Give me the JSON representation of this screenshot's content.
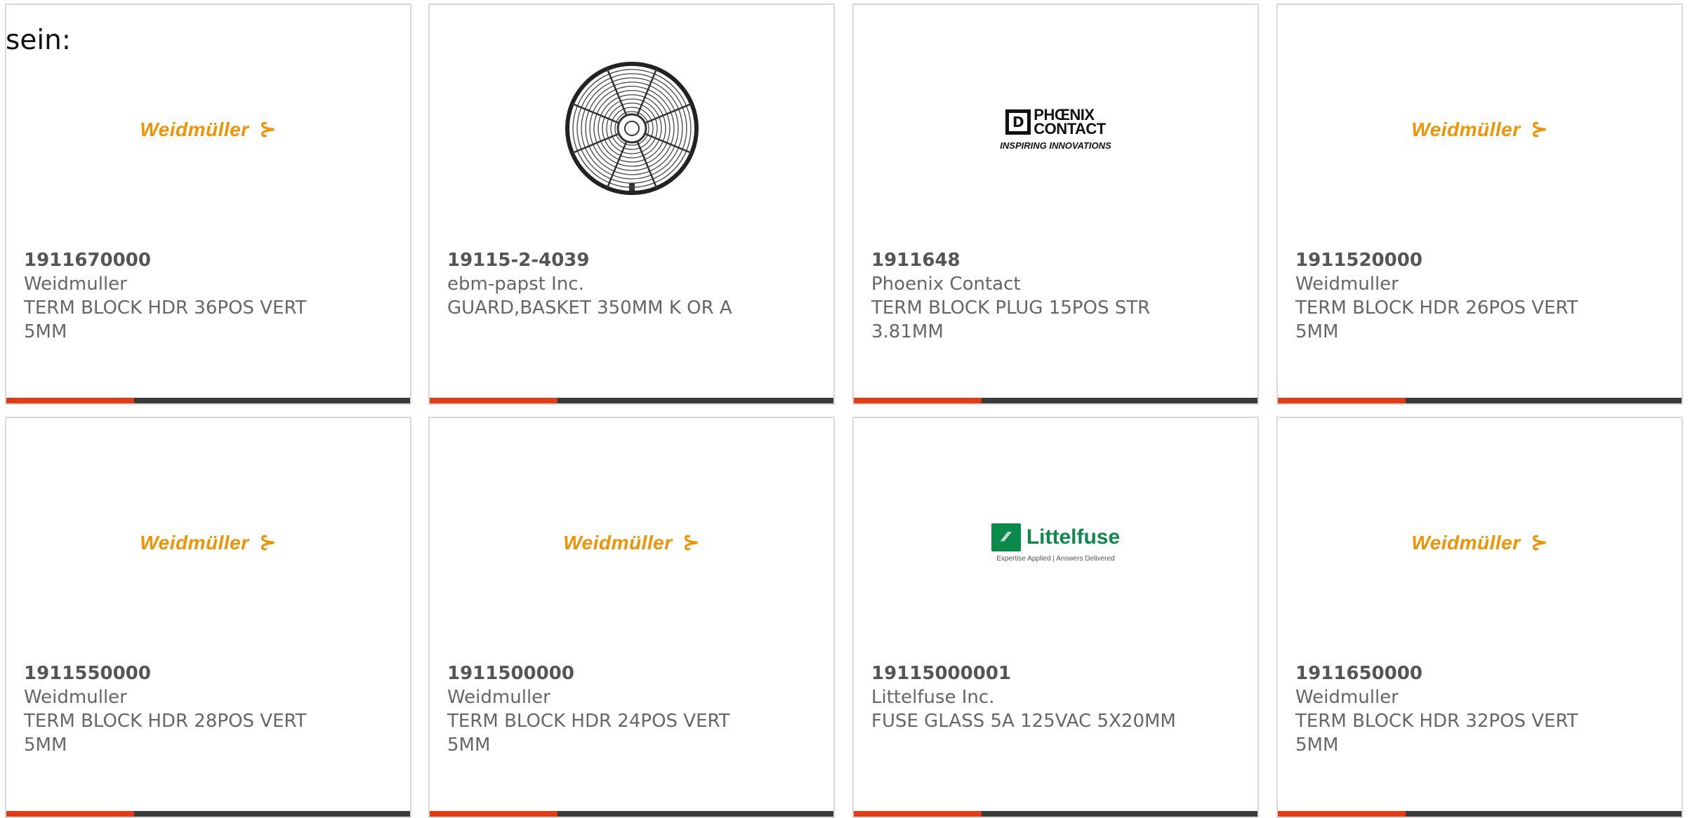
{
  "intro_text": "sein:",
  "colors": {
    "accent": "#e63b12",
    "bar_dark": "#3b3b3b",
    "weidmuller_orange": "#f39200",
    "littelfuse_green": "#0b8a4a"
  },
  "logos": {
    "weidmuller": {
      "wordmark": "Weidmüller",
      "symbol": "⊱"
    },
    "phoenix": {
      "box_glyph": "D",
      "line1": "PHŒNIX",
      "line2": "CONTACT",
      "tagline": "INSPIRING INNOVATIONS"
    },
    "littelfuse": {
      "mark": "⁄⁄",
      "wordmark": "Littelfuse",
      "tagline": "Expertise Applied | Answers Delivered"
    },
    "fan_guard": {
      "icon": "fan-guard-icon"
    }
  },
  "products": [
    {
      "part_number": "1911670000",
      "manufacturer": "Weidmuller",
      "description": "TERM BLOCK HDR 36POS VERT\n5MM",
      "logo": "weidmuller"
    },
    {
      "part_number": "19115-2-4039",
      "manufacturer": "ebm-papst Inc.",
      "description": "GUARD,BASKET 350MM K OR A",
      "logo": "fan_guard"
    },
    {
      "part_number": "1911648",
      "manufacturer": "Phoenix Contact",
      "description": "TERM BLOCK PLUG 15POS STR\n3.81MM",
      "logo": "phoenix"
    },
    {
      "part_number": "1911520000",
      "manufacturer": "Weidmuller",
      "description": "TERM BLOCK HDR 26POS VERT\n5MM",
      "logo": "weidmuller"
    },
    {
      "part_number": "1911550000",
      "manufacturer": "Weidmuller",
      "description": "TERM BLOCK HDR 28POS VERT\n5MM",
      "logo": "weidmuller"
    },
    {
      "part_number": "1911500000",
      "manufacturer": "Weidmuller",
      "description": "TERM BLOCK HDR 24POS VERT\n5MM",
      "logo": "weidmuller"
    },
    {
      "part_number": "19115000001",
      "manufacturer": "Littelfuse Inc.",
      "description": "FUSE GLASS 5A 125VAC 5X20MM",
      "logo": "littelfuse"
    },
    {
      "part_number": "1911650000",
      "manufacturer": "Weidmuller",
      "description": "TERM BLOCK HDR 32POS VERT\n5MM",
      "logo": "weidmuller"
    }
  ]
}
